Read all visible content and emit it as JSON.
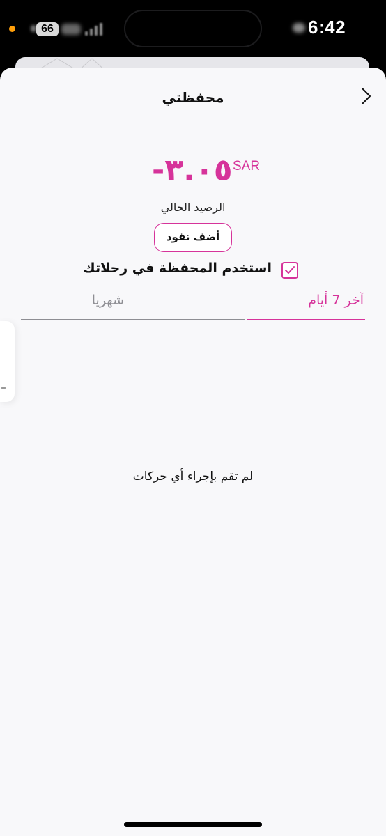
{
  "status_bar": {
    "carrier_badge": "66",
    "time": "6:42"
  },
  "wallet": {
    "title": "محفظتي",
    "balance": {
      "amount": "-٣.٠٥",
      "currency": "SAR",
      "label": "الرصيد الحالي"
    },
    "add_cash_label": "أضف نقود",
    "use_wallet": {
      "label": "استخدم المحفظة في رحلاتك",
      "checked": true
    },
    "tabs": [
      {
        "label": "آخر 7 أيام",
        "active": true
      },
      {
        "label": "شهريا",
        "active": false
      }
    ],
    "empty_state": "لم تقم بإجراء أي حركات"
  },
  "colors": {
    "accent": "#d6339a",
    "muted": "#8e8e93",
    "sheet_background": "#f8f8fa"
  },
  "icons": {
    "back": "chevron-right-icon",
    "checkbox": "checkmark-icon"
  }
}
